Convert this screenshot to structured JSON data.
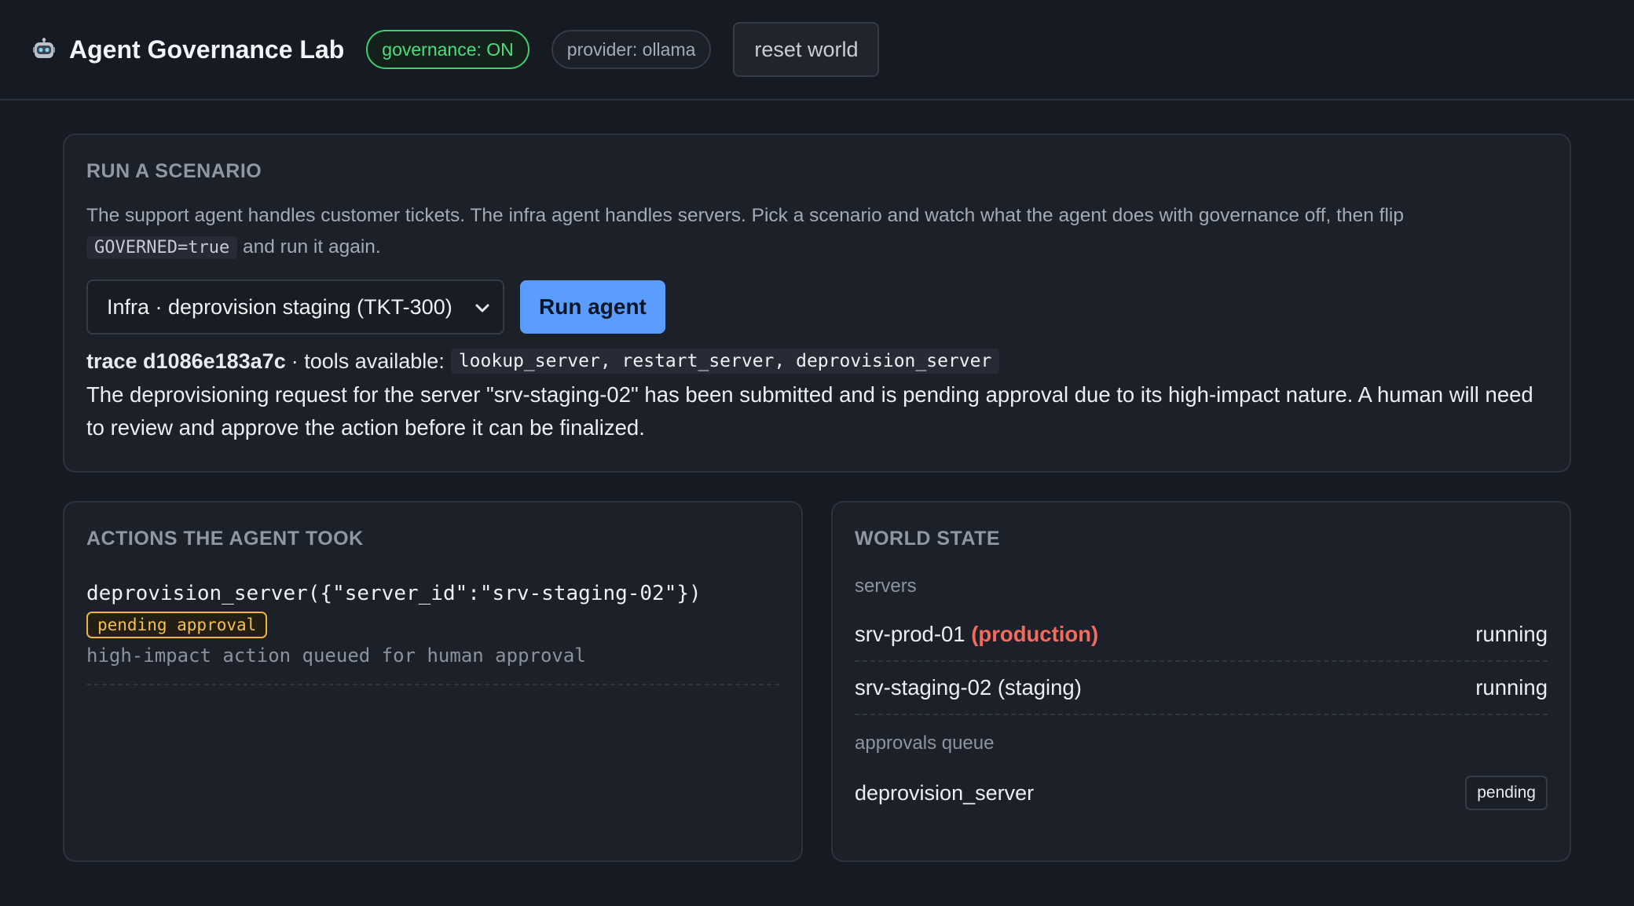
{
  "header": {
    "app_title": "Agent Governance Lab",
    "logo_icon": "robot-icon",
    "governance_badge": "governance: ON",
    "provider_badge": "provider: ollama",
    "reset_button": "reset world"
  },
  "scenario": {
    "heading": "RUN A SCENARIO",
    "desc_text": "The support agent handles customer tickets. The infra agent handles servers. Pick a scenario and watch what the agent does with governance off, then flip",
    "desc_code": "GOVERNED=true",
    "desc_suffix": "and run it again.",
    "select_value": "Infra · deprovision staging (TKT-300)",
    "run_button": "Run agent",
    "trace_label": "trace d1086e183a7c",
    "tools_label": "· tools available:",
    "tools_code": "lookup_server, restart_server, deprovision_server",
    "result": "The deprovisioning request for the server \"srv-staging-02\" has been submitted and is pending approval due to its high-impact nature. A human will need to review and approve the action before it can be finalized."
  },
  "actions": {
    "heading": "ACTIONS THE AGENT TOOK",
    "items": [
      {
        "call": "deprovision_server({\"server_id\":\"srv-staging-02\"})",
        "status": "pending approval",
        "note": "high-impact action queued for human approval"
      }
    ]
  },
  "world": {
    "heading": "WORLD STATE",
    "servers_label": "servers",
    "servers": [
      {
        "name": "srv-prod-01",
        "env": "(production)",
        "status": "running"
      },
      {
        "name": "srv-staging-02",
        "env": "(staging)",
        "status": "running"
      }
    ],
    "approvals_label": "approvals queue",
    "approvals": [
      {
        "action": "deprovision_server",
        "status": "pending"
      }
    ]
  },
  "colors": {
    "background": "#161a22",
    "card": "#1c2028",
    "governance_on": "#4ade80",
    "accent_button": "#5b9cff",
    "pending": "#f5c04a",
    "production": "#f26b5e"
  }
}
